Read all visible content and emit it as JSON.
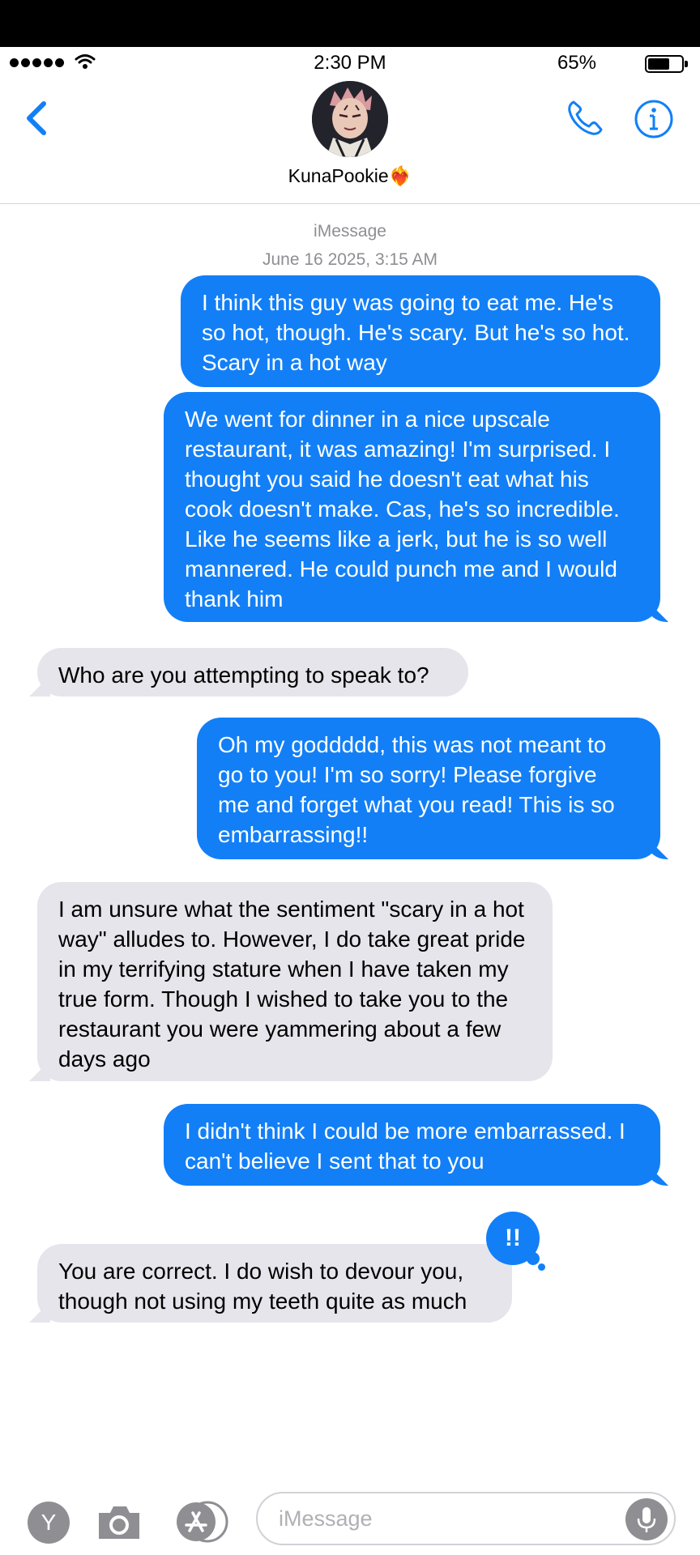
{
  "status_bar": {
    "time": "2:30 PM",
    "battery_percent": "65%",
    "battery_level": 0.65
  },
  "header": {
    "contact_name": "KunaPookie",
    "contact_emoji": "❤️‍🔥"
  },
  "thread": {
    "service": "iMessage",
    "timestamp": "June 16 2025, 3:15 AM",
    "messages": [
      {
        "direction": "outgoing",
        "text": "I think this guy was going to eat me.  He's so hot, though.  He's scary.  But he's so hot.  Scary in a hot way"
      },
      {
        "direction": "outgoing",
        "text": "We went for dinner in a nice upscale restaurant, it was amazing!  I'm surprised.  I thought you said he doesn't eat what his cook doesn't make.  Cas, he's so incredible.  Like he seems like a jerk, but he is so well mannered.  He could punch me and I would thank him"
      },
      {
        "direction": "incoming",
        "text": "Who are you attempting to speak to?"
      },
      {
        "direction": "outgoing",
        "text": "Oh my goddddd, this was not meant to go to you!  I'm so sorry!  Please forgive me and forget what you read!  This is so embarrassing!!"
      },
      {
        "direction": "incoming",
        "text": "I am unsure what the sentiment \"scary in a hot way\" alludes to.  However, I do take great pride in my terrifying stature when I have taken my true form.  Though I wished to take you to the restaurant you were yammering about a few days ago"
      },
      {
        "direction": "outgoing",
        "text": "I didn't think I could be more embarrassed.  I can't believe I sent that to you"
      },
      {
        "direction": "incoming",
        "text": "You are correct.  I do wish to devour you, though not using my teeth quite as much",
        "tapback": "!!"
      }
    ]
  },
  "input_bar": {
    "app_button_label": "Y",
    "placeholder": "iMessage"
  },
  "colors": {
    "outgoing_bubble": "#127ff7",
    "incoming_bubble": "#e6e5eb",
    "accent": "#127ff7"
  }
}
